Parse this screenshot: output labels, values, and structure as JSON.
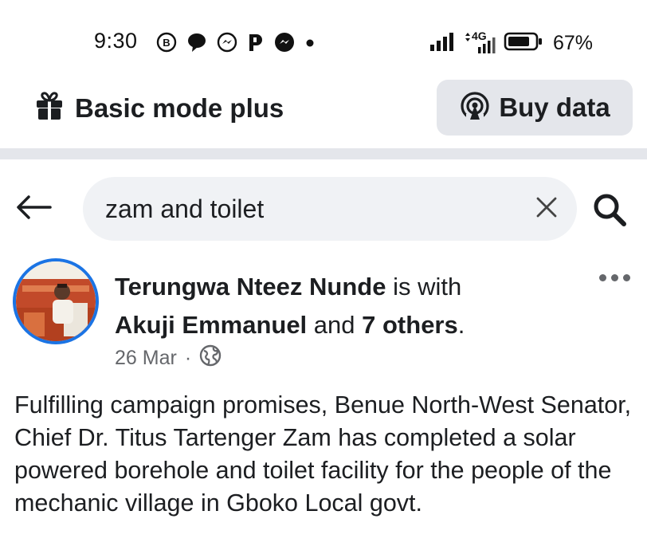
{
  "status_bar": {
    "time": "9:30",
    "network": "4G",
    "battery_percent": "67%",
    "notification_icons": [
      "bbm-icon",
      "chat-bubble-icon",
      "messenger-icon",
      "p-icon",
      "messenger-icon",
      "dot-icon"
    ]
  },
  "top_bar": {
    "mode_title": "Basic mode plus",
    "buy_data_label": "Buy data"
  },
  "search": {
    "query": "zam and toilet"
  },
  "post": {
    "author": "Terungwa Nteez Nunde",
    "with_text": " is with",
    "tagged": "Akuji Emmanuel",
    "and_text": " and ",
    "others": "7 others",
    "period": ".",
    "date": "26 Mar",
    "separator": "·",
    "audience": "public",
    "body": "Fulfilling campaign promises, Benue North-West Senator, Chief Dr. Titus Tartenger Zam has completed a solar powered borehole and toilet facility for the people of the mechanic village in Gboko Local govt."
  },
  "colors": {
    "accent_blue": "#1b74e4",
    "button_gray": "#e4e6eb",
    "search_bg": "#f0f2f5",
    "secondary_text": "#65676b"
  }
}
